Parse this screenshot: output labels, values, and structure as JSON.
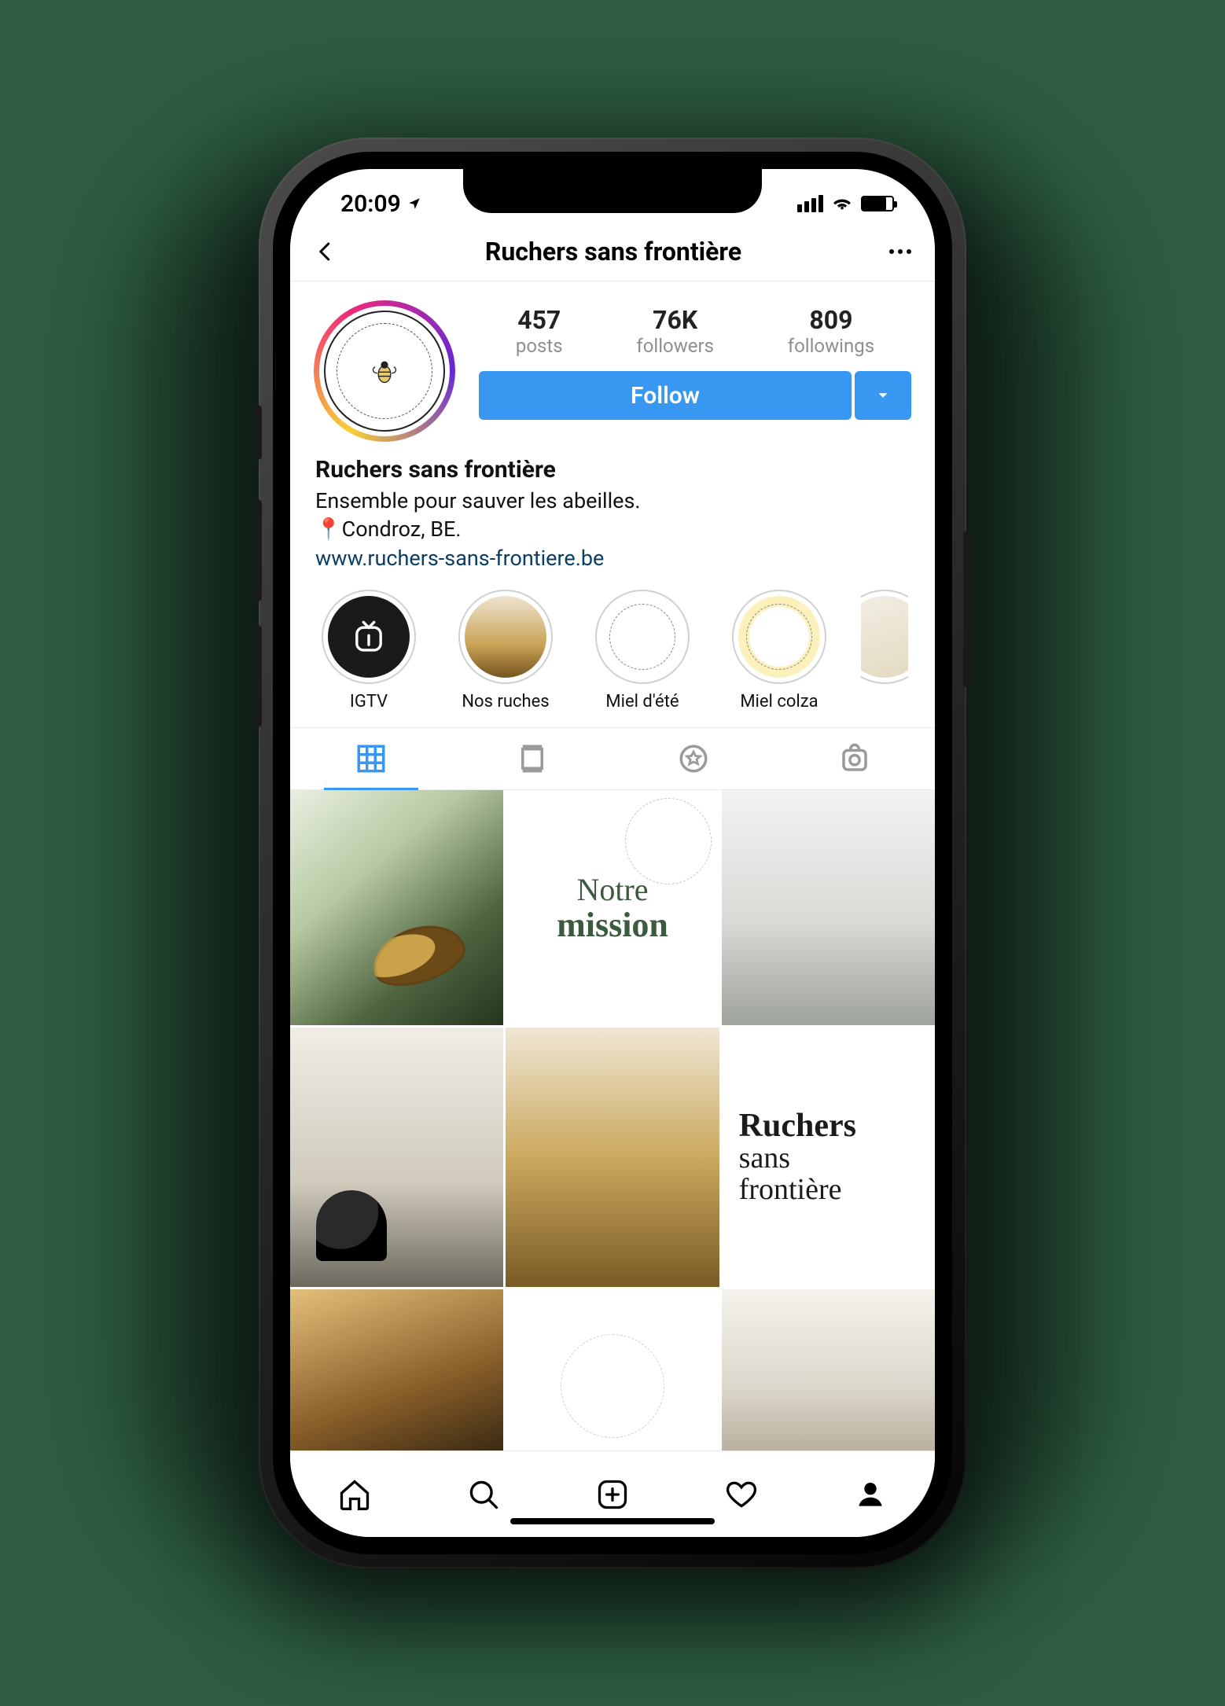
{
  "status": {
    "time": "20:09"
  },
  "header": {
    "title": "Ruchers sans frontière"
  },
  "profile": {
    "stats": {
      "posts": {
        "value": "457",
        "label": "posts"
      },
      "followers": {
        "value": "76K",
        "label": "followers"
      },
      "followings": {
        "value": "809",
        "label": "followings"
      }
    },
    "follow_label": "Follow"
  },
  "bio": {
    "name": "Ruchers sans frontière",
    "tagline": "Ensemble pour sauver les abeilles.",
    "location_pin": "📍",
    "location": "Condroz, BE.",
    "website": "www.ruchers-sans-frontiere.be"
  },
  "highlights": [
    {
      "label": "IGTV",
      "kind": "igtv"
    },
    {
      "label": "Nos ruches",
      "kind": "photo"
    },
    {
      "label": "Miel d'été",
      "kind": "logo"
    },
    {
      "label": "Miel colza",
      "kind": "logo"
    }
  ],
  "view_tabs": [
    "grid",
    "feed",
    "star",
    "tagged"
  ],
  "feed": {
    "mission_top": "Notre",
    "mission_bottom": "mission",
    "brand_l1": "Ruchers",
    "brand_l2": "sans",
    "brand_l3": "frontière"
  },
  "bottom_nav": [
    "home",
    "search",
    "add",
    "activity",
    "profile"
  ]
}
